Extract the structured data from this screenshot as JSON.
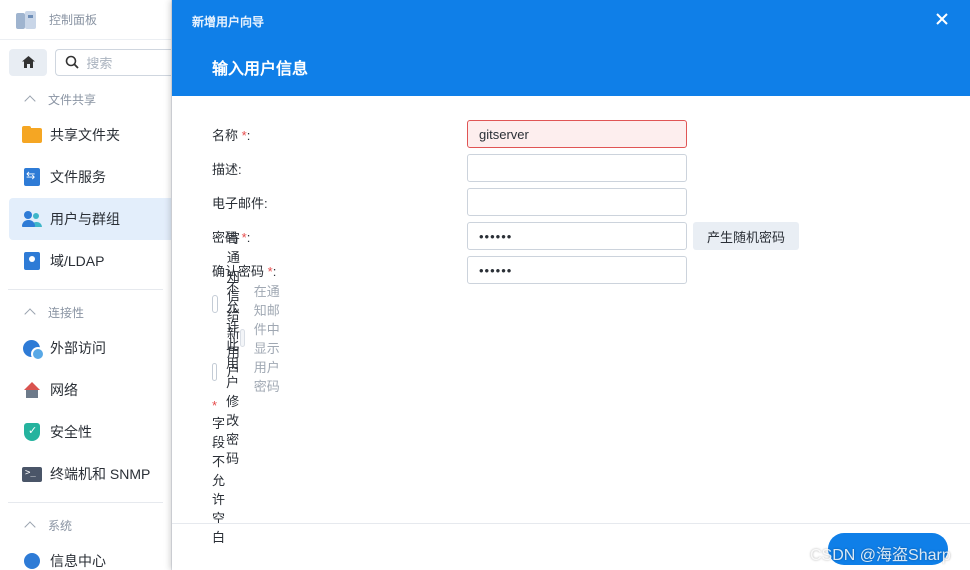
{
  "app": {
    "title": "控制面板"
  },
  "sidebar": {
    "search_placeholder": "搜索",
    "sections": [
      {
        "label": "文件共享",
        "items": [
          {
            "label": "共享文件夹",
            "icon": "shared-folder-icon"
          },
          {
            "label": "文件服务",
            "icon": "file-services-icon"
          },
          {
            "label": "用户与群组",
            "icon": "users-groups-icon",
            "active": true
          },
          {
            "label": "域/LDAP",
            "icon": "domain-ldap-icon"
          }
        ]
      },
      {
        "label": "连接性",
        "items": [
          {
            "label": "外部访问",
            "icon": "external-access-icon"
          },
          {
            "label": "网络",
            "icon": "network-icon"
          },
          {
            "label": "安全性",
            "icon": "security-icon"
          },
          {
            "label": "终端机和 SNMP",
            "icon": "terminal-snmp-icon"
          }
        ]
      },
      {
        "label": "系统",
        "items": [
          {
            "label": "信息中心",
            "icon": "info-center-icon"
          }
        ]
      }
    ]
  },
  "dialog": {
    "title": "新增用户向导",
    "step_title": "输入用户信息",
    "fields": {
      "name": {
        "label": "名称",
        "required": "*",
        "colon": ":",
        "value": "gitserver"
      },
      "description": {
        "label": "描述:",
        "value": ""
      },
      "email": {
        "label": "电子邮件:",
        "value": ""
      },
      "password": {
        "label": "密码",
        "required": "*",
        "colon": ":",
        "value": "••••••"
      },
      "confirm_password": {
        "label": "确认密码",
        "required": "*",
        "colon": ":",
        "value": "••••••"
      }
    },
    "generate_password_button": "产生随机密码",
    "checkboxes": {
      "send_notification": {
        "label": "寄通知信给新用户",
        "checked": false
      },
      "show_password_in_mail": {
        "label": "在通知邮件中显示用户密码",
        "checked": false,
        "disabled": true
      },
      "disallow_password_change": {
        "label": "不允许此用户修改密码",
        "checked": false
      }
    },
    "required_note": {
      "asterisk": "*",
      "text": " 字段不允许空白"
    },
    "close_icon": "close-icon",
    "next_button": ""
  },
  "watermark": "CSDN @海盗Sharp",
  "colors": {
    "accent": "#0f7fe8",
    "error": "#e64b4b",
    "active_bg": "#e3eefb"
  }
}
